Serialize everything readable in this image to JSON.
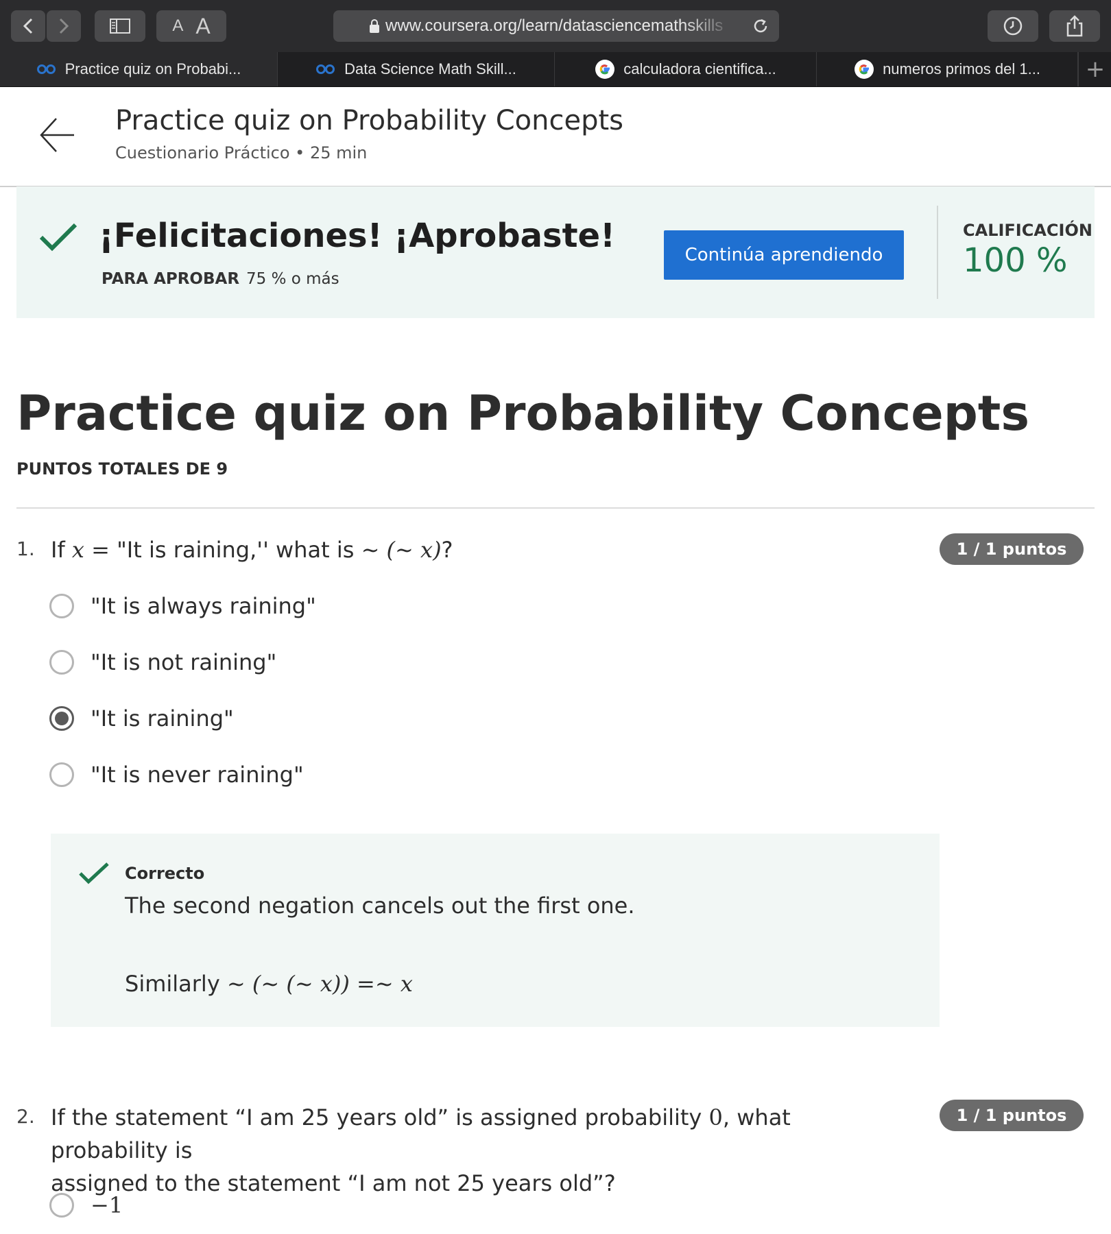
{
  "browser": {
    "url": "www.coursera.org/learn/datasciencemathskills",
    "reader_letters": [
      "A",
      "A"
    ],
    "tabs": [
      {
        "label": "Practice quiz on Probabi...",
        "icon": "coursera-icon"
      },
      {
        "label": "Data Science Math Skill...",
        "icon": "coursera-icon"
      },
      {
        "label": "calculadora cientifica...",
        "icon": "google-icon"
      },
      {
        "label": "numeros primos del 1...",
        "icon": "google-icon"
      }
    ],
    "new_tab": "+"
  },
  "header": {
    "title": "Practice quiz on Probability Concepts",
    "subtitle": "Cuestionario Práctico • 25 min"
  },
  "banner": {
    "title": "¡Felicitaciones! ¡Aprobaste!",
    "pass_label": "PARA APROBAR",
    "pass_value": "75 % o más",
    "button": "Continúa aprendiendo",
    "grade_label": "CALIFICACIÓN",
    "grade_value": "100 %",
    "accent": "#1f70d1",
    "success": "#1f7a4e"
  },
  "quiz": {
    "title": "Practice quiz on Probability Concepts",
    "total": "PUNTOS TOTALES DE 9",
    "q1": {
      "number": "1.",
      "text_pre": "If ",
      "text_math1": "x = ",
      "text_mid": "\"It is raining,'' what is ",
      "text_math2": "∼ (∼ x)",
      "text_post": "?",
      "points": "1 / 1 puntos",
      "options": [
        "\"It is always raining\"",
        "\"It is not raining\"",
        "\"It is raining\"",
        "\"It is never raining\""
      ],
      "selected_index": 2,
      "feedback_title": "Correcto",
      "feedback_text": "The second negation cancels out the first one.",
      "feedback_similarly": "Similarly ",
      "feedback_math": "∼ (∼ (∼ x)) =∼ x"
    },
    "q2": {
      "number": "2.",
      "line1_pre": "If the statement “I am 25 years old” is assigned probability ",
      "line1_math": "0",
      "line1_post": ", what probability is",
      "line2": "assigned to the statement “I am not 25 years old”?",
      "points": "1 / 1 puntos",
      "option1": "−1"
    }
  }
}
